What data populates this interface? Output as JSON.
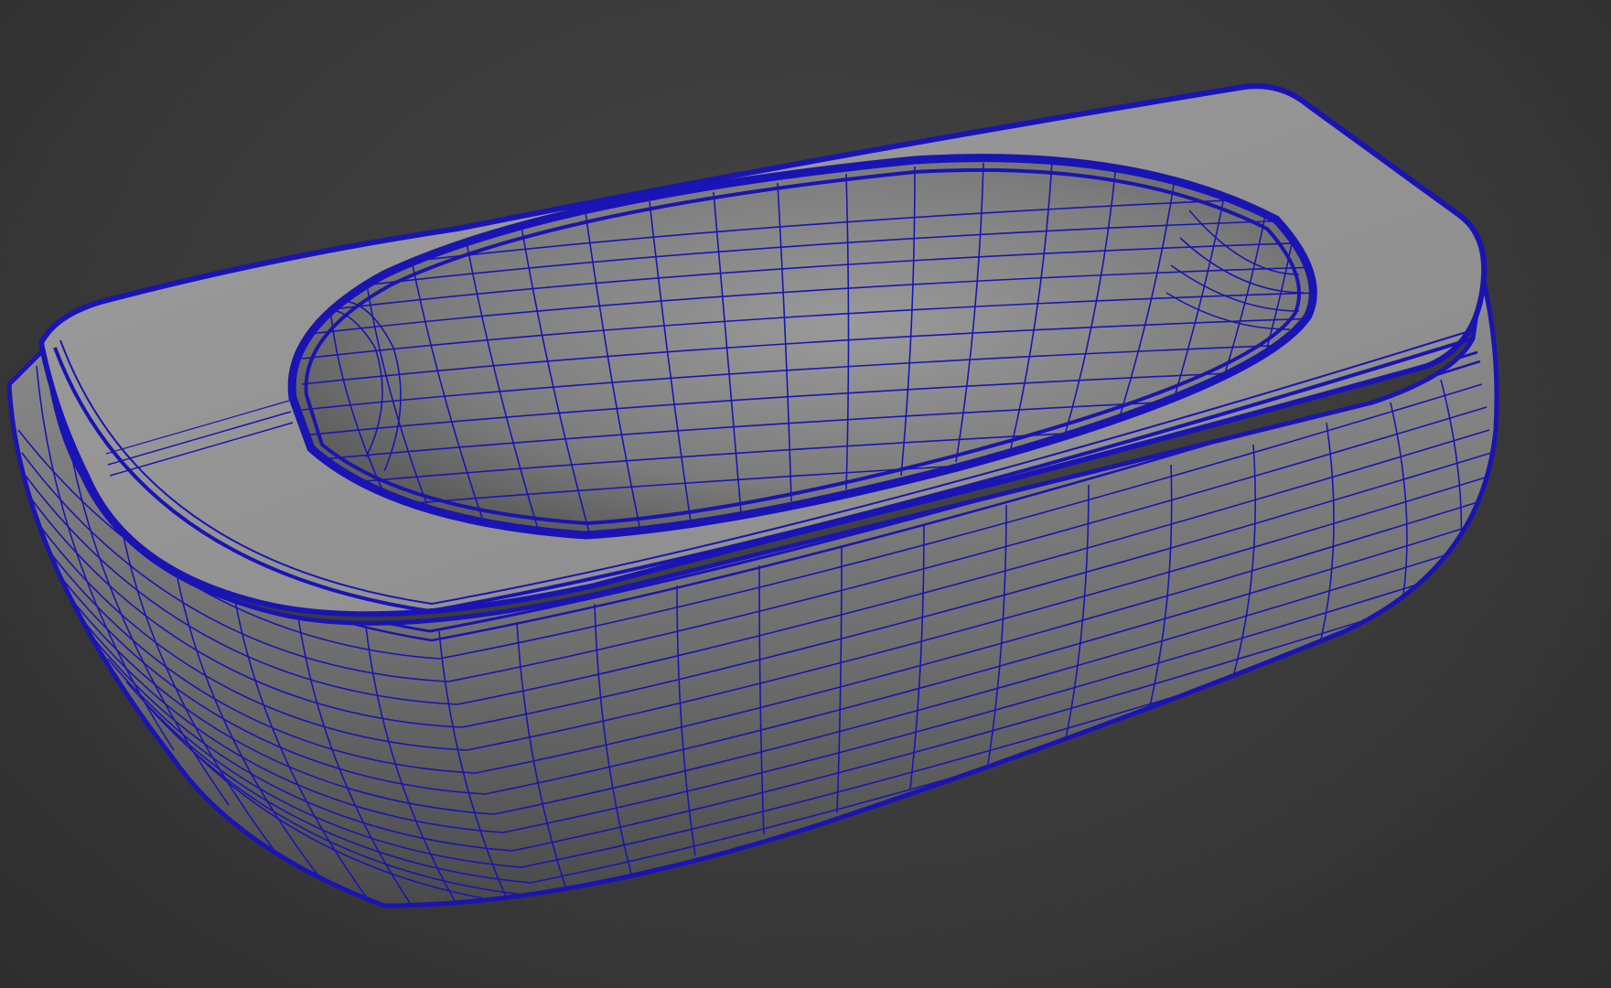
{
  "viewport": {
    "background_color": "#3a3a3a",
    "mesh_fill_color": "#8c8c8c",
    "wire_color": "#1a14b4",
    "model": "bathtub-mesh"
  }
}
